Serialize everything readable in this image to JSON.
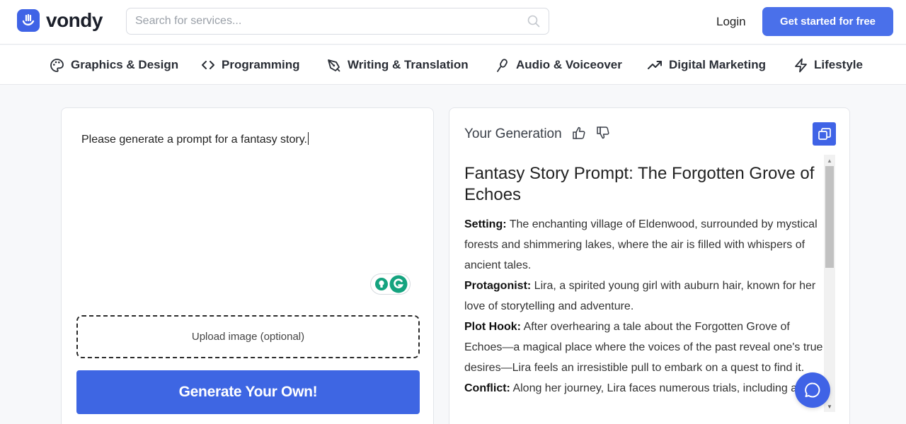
{
  "header": {
    "logo_text": "vondy",
    "search_placeholder": "Search for services...",
    "login_label": "Login",
    "cta_label": "Get started for free"
  },
  "nav": {
    "items": [
      {
        "label": "Graphics & Design",
        "icon": "palette-icon"
      },
      {
        "label": "Programming",
        "icon": "code-icon"
      },
      {
        "label": "Writing & Translation",
        "icon": "pen-nib-icon"
      },
      {
        "label": "Audio & Voiceover",
        "icon": "microphone-icon"
      },
      {
        "label": "Digital Marketing",
        "icon": "trending-up-icon"
      },
      {
        "label": "Lifestyle",
        "icon": "lightning-icon"
      }
    ]
  },
  "input_panel": {
    "prompt_value": "Please generate a prompt for a fantasy story.",
    "upload_label": "Upload image (optional)",
    "generate_label": "Generate Your Own!"
  },
  "output_panel": {
    "title": "Your Generation",
    "heading": "Fantasy Story Prompt: The Forgotten Grove of Echoes",
    "sections": [
      {
        "label": "Setting:",
        "text": " The enchanting village of Eldenwood, surrounded by mystical forests and shimmering lakes, where the air is filled with whispers of ancient tales."
      },
      {
        "label": "Protagonist:",
        "text": " Lira, a spirited young girl with auburn hair, known for her love of storytelling and adventure."
      },
      {
        "label": "Plot Hook:",
        "text": " After overhearing a tale about the Forgotten Grove of Echoes—a magical place where the voices of the past reveal one's true desires—Lira feels an irresistible pull to embark on a quest to find it."
      },
      {
        "label": "Conflict:",
        "text": " Along her journey, Lira faces numerous trials, including a"
      }
    ]
  },
  "colors": {
    "accent": "#3f63e6",
    "cta": "#4a70ea",
    "generate_button": "#3e66e3"
  }
}
